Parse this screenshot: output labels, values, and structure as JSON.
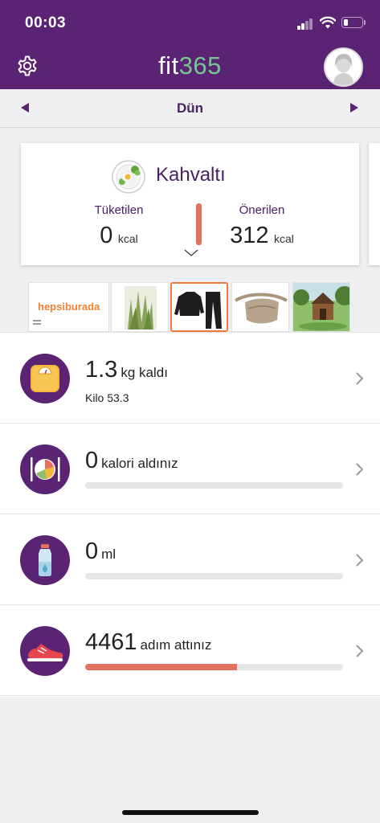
{
  "status_bar": {
    "time": "00:03",
    "battery_level": 0.25
  },
  "header": {
    "logo_part1": "fit",
    "logo_part2": "365",
    "colors": {
      "primary": "#5b2373",
      "logo_accent": "#74c88f"
    }
  },
  "date_nav": {
    "label": "Dün"
  },
  "meal_card": {
    "title": "Kahvaltı",
    "consumed_label": "Tüketilen",
    "consumed_value": "0",
    "consumed_unit": "kcal",
    "recommended_label": "Önerilen",
    "recommended_value": "312",
    "recommended_unit": "kcal",
    "accent_color": "#e2715d"
  },
  "ad_strip": {
    "brand": "hepsiburada",
    "items": [
      "plant-product",
      "tracksuit-product",
      "waist-bag-product",
      "garden-house-product"
    ],
    "selected_index": 1
  },
  "rows": [
    {
      "icon": "scale-icon",
      "value": "1.3",
      "label": "kg kaldı",
      "sub": "Kilo 53.3"
    },
    {
      "icon": "meal-plate-icon",
      "value": "0",
      "label": "kalori aldınız",
      "progress": 0
    },
    {
      "icon": "water-bottle-icon",
      "value": "0",
      "label": "ml",
      "progress": 0
    },
    {
      "icon": "sneaker-icon",
      "value": "4461",
      "label": "adım attınız",
      "progress": 0.59
    }
  ]
}
